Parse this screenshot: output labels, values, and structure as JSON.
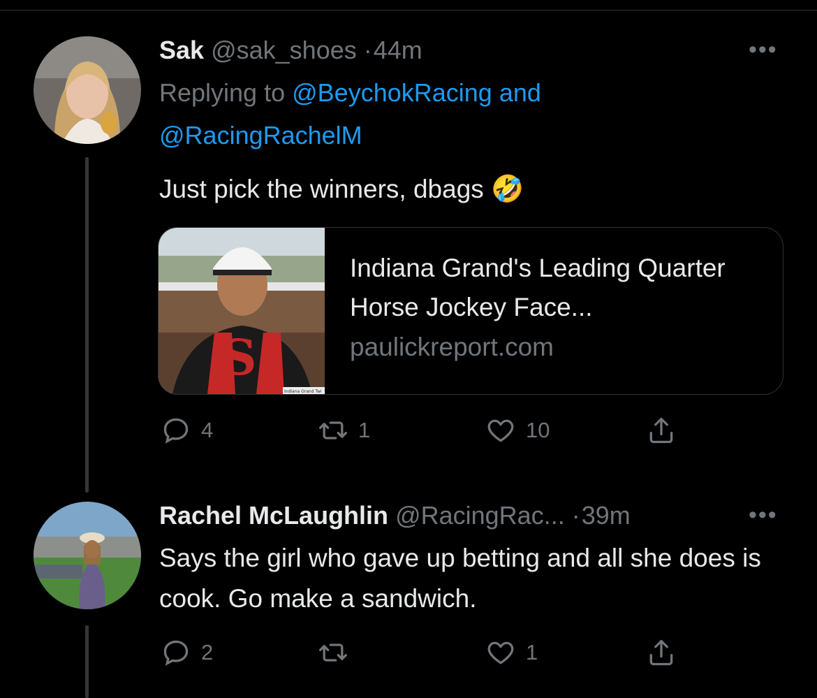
{
  "tweets": [
    {
      "name": "Sak",
      "handle": "@sak_shoes",
      "time": "44m",
      "replying_label": "Replying to",
      "replying_to_1": "@BeychokRacing",
      "replying_and": "and",
      "replying_to_2": "@RacingRachelM",
      "text": "Just pick the winners, dbags",
      "emoji": "🤣",
      "card": {
        "title": "Indiana Grand's Leading Quarter Horse Jockey Face...",
        "domain": "paulickreport.com",
        "image_caption": "Indiana Grand Twi"
      },
      "stats": {
        "replies": "4",
        "retweets": "1",
        "likes": "10"
      }
    },
    {
      "name": "Rachel McLaughlin",
      "handle": "@RacingRac...",
      "time": "39m",
      "text": "Says the girl who gave up betting and all she does is cook. Go make a sandwich.",
      "stats": {
        "replies": "2",
        "retweets": "",
        "likes": "1"
      }
    }
  ],
  "separator": "·",
  "more_label": "•••",
  "colors": {
    "background": "#000000",
    "text": "#e7e9ea",
    "muted": "#71767b",
    "link": "#1d9bf0"
  },
  "icons": [
    "reply-icon",
    "retweet-icon",
    "like-icon",
    "share-icon",
    "more-icon"
  ]
}
